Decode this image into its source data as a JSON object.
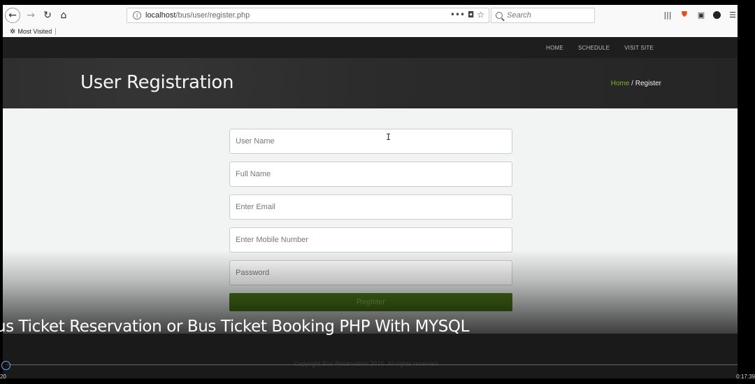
{
  "browser": {
    "url_host": "localhost",
    "url_path": "/bus/user/register.php",
    "page_actions": "••• ◘ ☆",
    "search_placeholder": "Search",
    "bookmark_label": "Most Visited"
  },
  "site": {
    "nav": [
      "HOME",
      "SCHEDULE",
      "VISIT SITE"
    ],
    "page_title": "User Registration",
    "breadcrumb_home": "Home",
    "breadcrumb_sep": " / ",
    "breadcrumb_current": "Register"
  },
  "form": {
    "username_placeholder": "User Name",
    "fullname_placeholder": "Full Name",
    "email_placeholder": "Enter Email",
    "mobile_placeholder": "Enter Mobile Number",
    "password_placeholder": "Password",
    "submit_label": "Register"
  },
  "footer": {
    "copyright": "Copyright Bus Reservation 2015. All rights reserved."
  },
  "video": {
    "caption": "us Ticket Reservation or Bus Ticket Booking PHP With MYSQL",
    "time_current": "20",
    "time_total": "0:17:39",
    "progress_fraction": 0.0
  },
  "colors": {
    "accent_green": "#4b7a1a",
    "breadcrumb_green": "#7fae2e",
    "header_dark": "#1e1e1e"
  }
}
